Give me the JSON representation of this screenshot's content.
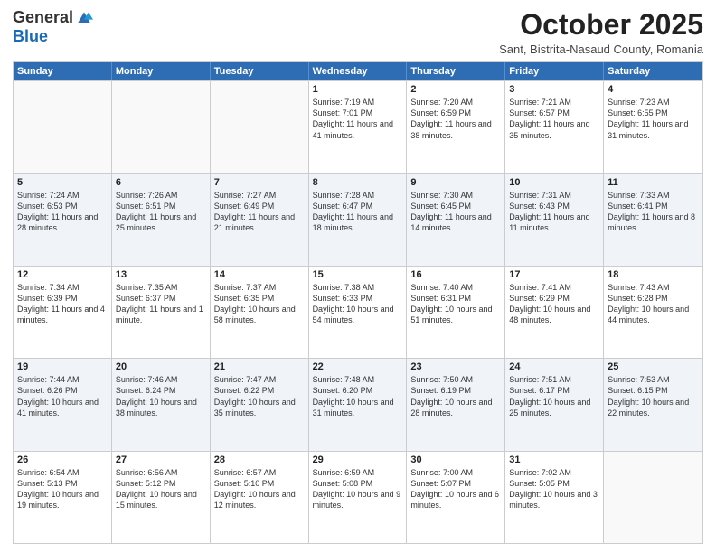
{
  "header": {
    "logo_general": "General",
    "logo_blue": "Blue",
    "month_title": "October 2025",
    "location": "Sant, Bistrita-Nasaud County, Romania"
  },
  "weekdays": [
    "Sunday",
    "Monday",
    "Tuesday",
    "Wednesday",
    "Thursday",
    "Friday",
    "Saturday"
  ],
  "weeks": [
    {
      "alt": false,
      "days": [
        {
          "number": "",
          "sunrise": "",
          "sunset": "",
          "daylight": ""
        },
        {
          "number": "",
          "sunrise": "",
          "sunset": "",
          "daylight": ""
        },
        {
          "number": "",
          "sunrise": "",
          "sunset": "",
          "daylight": ""
        },
        {
          "number": "1",
          "sunrise": "Sunrise: 7:19 AM",
          "sunset": "Sunset: 7:01 PM",
          "daylight": "Daylight: 11 hours and 41 minutes."
        },
        {
          "number": "2",
          "sunrise": "Sunrise: 7:20 AM",
          "sunset": "Sunset: 6:59 PM",
          "daylight": "Daylight: 11 hours and 38 minutes."
        },
        {
          "number": "3",
          "sunrise": "Sunrise: 7:21 AM",
          "sunset": "Sunset: 6:57 PM",
          "daylight": "Daylight: 11 hours and 35 minutes."
        },
        {
          "number": "4",
          "sunrise": "Sunrise: 7:23 AM",
          "sunset": "Sunset: 6:55 PM",
          "daylight": "Daylight: 11 hours and 31 minutes."
        }
      ]
    },
    {
      "alt": true,
      "days": [
        {
          "number": "5",
          "sunrise": "Sunrise: 7:24 AM",
          "sunset": "Sunset: 6:53 PM",
          "daylight": "Daylight: 11 hours and 28 minutes."
        },
        {
          "number": "6",
          "sunrise": "Sunrise: 7:26 AM",
          "sunset": "Sunset: 6:51 PM",
          "daylight": "Daylight: 11 hours and 25 minutes."
        },
        {
          "number": "7",
          "sunrise": "Sunrise: 7:27 AM",
          "sunset": "Sunset: 6:49 PM",
          "daylight": "Daylight: 11 hours and 21 minutes."
        },
        {
          "number": "8",
          "sunrise": "Sunrise: 7:28 AM",
          "sunset": "Sunset: 6:47 PM",
          "daylight": "Daylight: 11 hours and 18 minutes."
        },
        {
          "number": "9",
          "sunrise": "Sunrise: 7:30 AM",
          "sunset": "Sunset: 6:45 PM",
          "daylight": "Daylight: 11 hours and 14 minutes."
        },
        {
          "number": "10",
          "sunrise": "Sunrise: 7:31 AM",
          "sunset": "Sunset: 6:43 PM",
          "daylight": "Daylight: 11 hours and 11 minutes."
        },
        {
          "number": "11",
          "sunrise": "Sunrise: 7:33 AM",
          "sunset": "Sunset: 6:41 PM",
          "daylight": "Daylight: 11 hours and 8 minutes."
        }
      ]
    },
    {
      "alt": false,
      "days": [
        {
          "number": "12",
          "sunrise": "Sunrise: 7:34 AM",
          "sunset": "Sunset: 6:39 PM",
          "daylight": "Daylight: 11 hours and 4 minutes."
        },
        {
          "number": "13",
          "sunrise": "Sunrise: 7:35 AM",
          "sunset": "Sunset: 6:37 PM",
          "daylight": "Daylight: 11 hours and 1 minute."
        },
        {
          "number": "14",
          "sunrise": "Sunrise: 7:37 AM",
          "sunset": "Sunset: 6:35 PM",
          "daylight": "Daylight: 10 hours and 58 minutes."
        },
        {
          "number": "15",
          "sunrise": "Sunrise: 7:38 AM",
          "sunset": "Sunset: 6:33 PM",
          "daylight": "Daylight: 10 hours and 54 minutes."
        },
        {
          "number": "16",
          "sunrise": "Sunrise: 7:40 AM",
          "sunset": "Sunset: 6:31 PM",
          "daylight": "Daylight: 10 hours and 51 minutes."
        },
        {
          "number": "17",
          "sunrise": "Sunrise: 7:41 AM",
          "sunset": "Sunset: 6:29 PM",
          "daylight": "Daylight: 10 hours and 48 minutes."
        },
        {
          "number": "18",
          "sunrise": "Sunrise: 7:43 AM",
          "sunset": "Sunset: 6:28 PM",
          "daylight": "Daylight: 10 hours and 44 minutes."
        }
      ]
    },
    {
      "alt": true,
      "days": [
        {
          "number": "19",
          "sunrise": "Sunrise: 7:44 AM",
          "sunset": "Sunset: 6:26 PM",
          "daylight": "Daylight: 10 hours and 41 minutes."
        },
        {
          "number": "20",
          "sunrise": "Sunrise: 7:46 AM",
          "sunset": "Sunset: 6:24 PM",
          "daylight": "Daylight: 10 hours and 38 minutes."
        },
        {
          "number": "21",
          "sunrise": "Sunrise: 7:47 AM",
          "sunset": "Sunset: 6:22 PM",
          "daylight": "Daylight: 10 hours and 35 minutes."
        },
        {
          "number": "22",
          "sunrise": "Sunrise: 7:48 AM",
          "sunset": "Sunset: 6:20 PM",
          "daylight": "Daylight: 10 hours and 31 minutes."
        },
        {
          "number": "23",
          "sunrise": "Sunrise: 7:50 AM",
          "sunset": "Sunset: 6:19 PM",
          "daylight": "Daylight: 10 hours and 28 minutes."
        },
        {
          "number": "24",
          "sunrise": "Sunrise: 7:51 AM",
          "sunset": "Sunset: 6:17 PM",
          "daylight": "Daylight: 10 hours and 25 minutes."
        },
        {
          "number": "25",
          "sunrise": "Sunrise: 7:53 AM",
          "sunset": "Sunset: 6:15 PM",
          "daylight": "Daylight: 10 hours and 22 minutes."
        }
      ]
    },
    {
      "alt": false,
      "days": [
        {
          "number": "26",
          "sunrise": "Sunrise: 6:54 AM",
          "sunset": "Sunset: 5:13 PM",
          "daylight": "Daylight: 10 hours and 19 minutes."
        },
        {
          "number": "27",
          "sunrise": "Sunrise: 6:56 AM",
          "sunset": "Sunset: 5:12 PM",
          "daylight": "Daylight: 10 hours and 15 minutes."
        },
        {
          "number": "28",
          "sunrise": "Sunrise: 6:57 AM",
          "sunset": "Sunset: 5:10 PM",
          "daylight": "Daylight: 10 hours and 12 minutes."
        },
        {
          "number": "29",
          "sunrise": "Sunrise: 6:59 AM",
          "sunset": "Sunset: 5:08 PM",
          "daylight": "Daylight: 10 hours and 9 minutes."
        },
        {
          "number": "30",
          "sunrise": "Sunrise: 7:00 AM",
          "sunset": "Sunset: 5:07 PM",
          "daylight": "Daylight: 10 hours and 6 minutes."
        },
        {
          "number": "31",
          "sunrise": "Sunrise: 7:02 AM",
          "sunset": "Sunset: 5:05 PM",
          "daylight": "Daylight: 10 hours and 3 minutes."
        },
        {
          "number": "",
          "sunrise": "",
          "sunset": "",
          "daylight": ""
        }
      ]
    }
  ]
}
